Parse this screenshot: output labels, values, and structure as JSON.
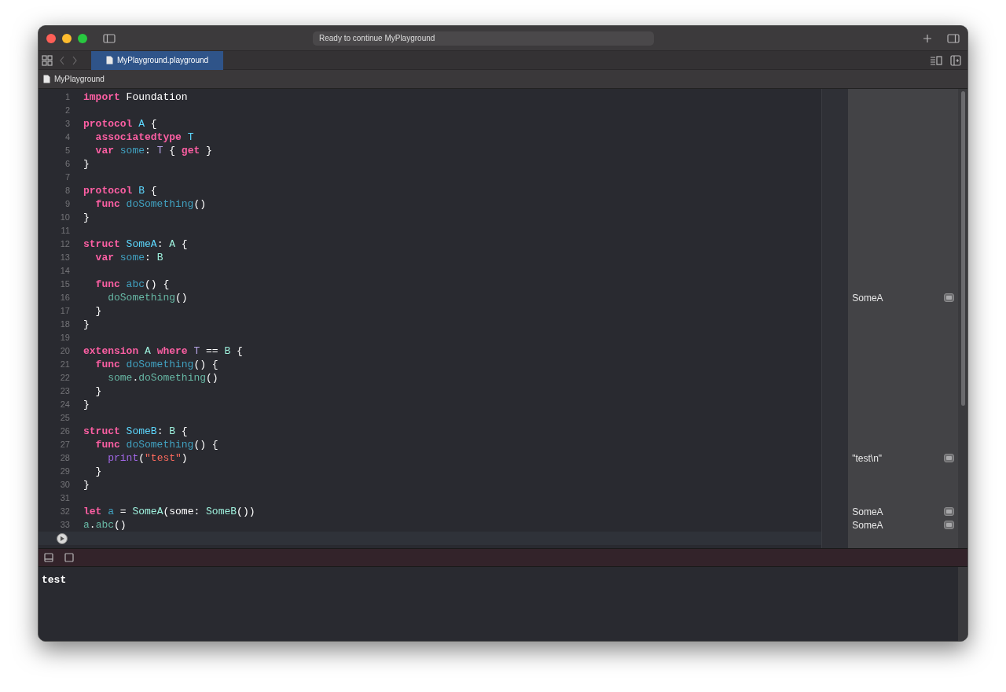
{
  "window": {
    "status": "Ready to continue MyPlayground"
  },
  "tabs": [
    {
      "label": "MyPlayground.playground",
      "selected": true
    }
  ],
  "breadcrumb": "MyPlayground",
  "lines": [
    {
      "number": "1",
      "tokens": [
        {
          "kind": "kw",
          "text": "import"
        },
        {
          "kind": "plain",
          "text": " Foundation"
        }
      ]
    },
    {
      "number": "2"
    },
    {
      "number": "3",
      "tokens": [
        {
          "kind": "kw",
          "text": "protocol "
        },
        {
          "kind": "decl",
          "text": "A"
        },
        {
          "kind": "plain",
          "text": " {"
        }
      ]
    },
    {
      "number": "4",
      "tokens": [
        {
          "kind": "kw",
          "text": "  associatedtype "
        },
        {
          "kind": "decl",
          "text": "T"
        }
      ]
    },
    {
      "number": "5",
      "tokens": [
        {
          "kind": "kw",
          "text": "  var "
        },
        {
          "kind": "name",
          "text": "some"
        },
        {
          "kind": "plain",
          "text": ": "
        },
        {
          "kind": "generic",
          "text": "T"
        },
        {
          "kind": "plain",
          "text": " { "
        },
        {
          "kind": "kw",
          "text": "get"
        },
        {
          "kind": "plain",
          "text": " }"
        }
      ]
    },
    {
      "number": "6",
      "tokens": [
        {
          "kind": "plain",
          "text": "}"
        }
      ]
    },
    {
      "number": "7"
    },
    {
      "number": "8",
      "tokens": [
        {
          "kind": "kw",
          "text": "protocol "
        },
        {
          "kind": "decl",
          "text": "B"
        },
        {
          "kind": "plain",
          "text": " {"
        }
      ]
    },
    {
      "number": "9",
      "tokens": [
        {
          "kind": "kw",
          "text": "  func "
        },
        {
          "kind": "name",
          "text": "doSomething"
        },
        {
          "kind": "plain",
          "text": "()"
        }
      ]
    },
    {
      "number": "10",
      "tokens": [
        {
          "kind": "plain",
          "text": "}"
        }
      ]
    },
    {
      "number": "11"
    },
    {
      "number": "12",
      "tokens": [
        {
          "kind": "kw",
          "text": "struct "
        },
        {
          "kind": "decl",
          "text": "SomeA"
        },
        {
          "kind": "plain",
          "text": ": "
        },
        {
          "kind": "ref",
          "text": "A"
        },
        {
          "kind": "plain",
          "text": " {"
        }
      ]
    },
    {
      "number": "13",
      "tokens": [
        {
          "kind": "kw",
          "text": "  var "
        },
        {
          "kind": "name",
          "text": "some"
        },
        {
          "kind": "plain",
          "text": ": "
        },
        {
          "kind": "ref",
          "text": "B"
        }
      ]
    },
    {
      "number": "14"
    },
    {
      "number": "15",
      "tokens": [
        {
          "kind": "kw",
          "text": "  func "
        },
        {
          "kind": "name",
          "text": "abc"
        },
        {
          "kind": "plain",
          "text": "() {"
        }
      ]
    },
    {
      "number": "16",
      "tokens": [
        {
          "kind": "call",
          "text": "    doSomething"
        },
        {
          "kind": "plain",
          "text": "()"
        }
      ],
      "result": "SomeA"
    },
    {
      "number": "17",
      "tokens": [
        {
          "kind": "plain",
          "text": "  }"
        }
      ]
    },
    {
      "number": "18",
      "tokens": [
        {
          "kind": "plain",
          "text": "}"
        }
      ]
    },
    {
      "number": "19"
    },
    {
      "number": "20",
      "tokens": [
        {
          "kind": "kw",
          "text": "extension "
        },
        {
          "kind": "ref",
          "text": "A "
        },
        {
          "kind": "kw",
          "text": "where "
        },
        {
          "kind": "generic",
          "text": "T"
        },
        {
          "kind": "plain",
          "text": " == "
        },
        {
          "kind": "ref",
          "text": "B"
        },
        {
          "kind": "plain",
          "text": " {"
        }
      ]
    },
    {
      "number": "21",
      "tokens": [
        {
          "kind": "kw",
          "text": "  func "
        },
        {
          "kind": "name",
          "text": "doSomething"
        },
        {
          "kind": "plain",
          "text": "() {"
        }
      ]
    },
    {
      "number": "22",
      "tokens": [
        {
          "kind": "call",
          "text": "    some"
        },
        {
          "kind": "plain",
          "text": "."
        },
        {
          "kind": "call",
          "text": "doSomething"
        },
        {
          "kind": "plain",
          "text": "()"
        }
      ]
    },
    {
      "number": "23",
      "tokens": [
        {
          "kind": "plain",
          "text": "  }"
        }
      ]
    },
    {
      "number": "24",
      "tokens": [
        {
          "kind": "plain",
          "text": "}"
        }
      ]
    },
    {
      "number": "25"
    },
    {
      "number": "26",
      "tokens": [
        {
          "kind": "kw",
          "text": "struct "
        },
        {
          "kind": "decl",
          "text": "SomeB"
        },
        {
          "kind": "plain",
          "text": ": "
        },
        {
          "kind": "ref",
          "text": "B"
        },
        {
          "kind": "plain",
          "text": " {"
        }
      ]
    },
    {
      "number": "27",
      "tokens": [
        {
          "kind": "kw",
          "text": "  func "
        },
        {
          "kind": "name",
          "text": "doSomething"
        },
        {
          "kind": "plain",
          "text": "() {"
        }
      ]
    },
    {
      "number": "28",
      "tokens": [
        {
          "kind": "builtin",
          "text": "    print"
        },
        {
          "kind": "plain",
          "text": "("
        },
        {
          "kind": "str",
          "text": "\"test\""
        },
        {
          "kind": "plain",
          "text": ")"
        }
      ],
      "result": "\"test\\n\""
    },
    {
      "number": "29",
      "tokens": [
        {
          "kind": "plain",
          "text": "  }"
        }
      ]
    },
    {
      "number": "30",
      "tokens": [
        {
          "kind": "plain",
          "text": "}"
        }
      ]
    },
    {
      "number": "31"
    },
    {
      "number": "32",
      "tokens": [
        {
          "kind": "kw",
          "text": "let "
        },
        {
          "kind": "name",
          "text": "a"
        },
        {
          "kind": "plain",
          "text": " = "
        },
        {
          "kind": "ref",
          "text": "SomeA"
        },
        {
          "kind": "plain",
          "text": "(some: "
        },
        {
          "kind": "ref",
          "text": "SomeB"
        },
        {
          "kind": "plain",
          "text": "())"
        }
      ],
      "result": "SomeA"
    },
    {
      "number": "33",
      "tokens": [
        {
          "kind": "call",
          "text": "a"
        },
        {
          "kind": "plain",
          "text": "."
        },
        {
          "kind": "call",
          "text": "abc"
        },
        {
          "kind": "plain",
          "text": "()"
        }
      ],
      "result": "SomeA"
    }
  ],
  "console": "test"
}
